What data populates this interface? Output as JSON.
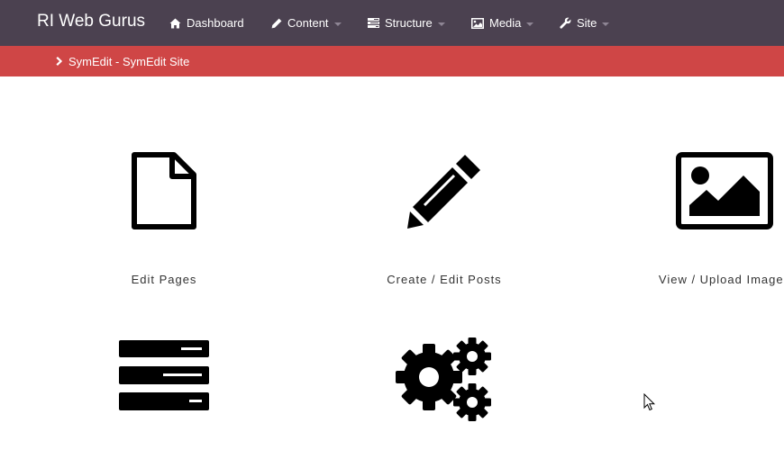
{
  "navbar": {
    "brand": "RI Web Gurus",
    "items": [
      {
        "label": "Dashboard",
        "icon": "home-icon"
      },
      {
        "label": "Content",
        "icon": "pencil-icon",
        "dropdown": true
      },
      {
        "label": "Structure",
        "icon": "tasks-icon",
        "dropdown": true
      },
      {
        "label": "Media",
        "icon": "picture-icon",
        "dropdown": true
      },
      {
        "label": "Site",
        "icon": "wrench-icon",
        "dropdown": true
      }
    ]
  },
  "breadcrumb": {
    "label": "SymEdit - SymEdit Site",
    "icon": "chevron-right-icon"
  },
  "tiles": [
    {
      "label": "Edit Pages",
      "icon": "file-icon"
    },
    {
      "label": "Create / Edit Posts",
      "icon": "pencil-icon"
    },
    {
      "label": "View / Upload Images",
      "icon": "picture-icon"
    },
    {
      "label": "",
      "icon": "tasks-icon"
    },
    {
      "label": "",
      "icon": "cogs-icon"
    }
  ],
  "colors": {
    "navbar": "#4b4150",
    "subbar": "#cf4646",
    "icon": "#000000"
  }
}
